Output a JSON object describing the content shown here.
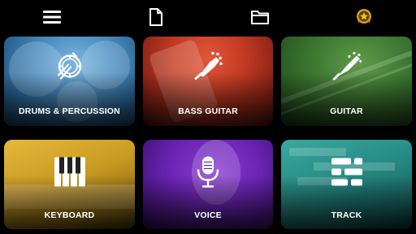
{
  "topbar": {
    "menu_icon": "hamburger-menu-icon",
    "new_file_icon": "document-icon",
    "open_folder_icon": "folder-icon",
    "premium_icon": "medal-star-icon"
  },
  "tiles": [
    {
      "label": "DRUMS & PERCUSSION",
      "icon": "drum-icon",
      "color": "#4d8fc2"
    },
    {
      "label": "BASS GUITAR",
      "icon": "bass-headstock-icon",
      "color": "#c23a22"
    },
    {
      "label": "GUITAR",
      "icon": "guitar-headstock-icon",
      "color": "#3f7a33"
    },
    {
      "label": "KEYBOARD",
      "icon": "piano-keys-icon",
      "color": "#c99a22"
    },
    {
      "label": "VOICE",
      "icon": "microphone-icon",
      "color": "#6a24b4"
    },
    {
      "label": "TRACK",
      "icon": "tracks-icon",
      "color": "#268a84"
    }
  ]
}
